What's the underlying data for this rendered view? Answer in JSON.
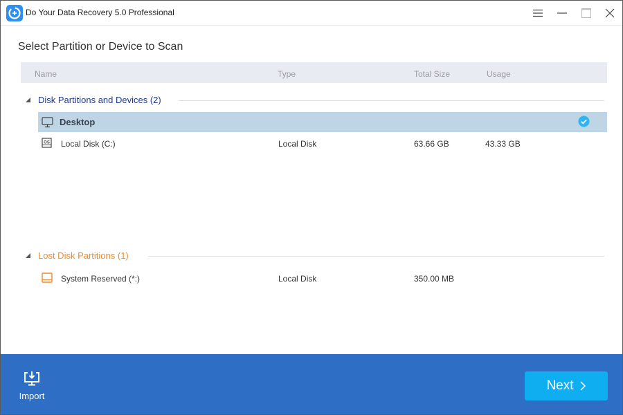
{
  "window": {
    "title": "Do Your Data Recovery 5.0 Professional",
    "controls": {
      "menu": "menu-icon",
      "minimize": "minimize-icon",
      "maximize": "maximize-icon",
      "close": "close-icon"
    }
  },
  "main": {
    "heading": "Select Partition or Device to Scan",
    "columns": [
      "Name",
      "Type",
      "Total Size",
      "Usage"
    ],
    "groups": [
      {
        "label": "Disk Partitions and Devices (2)",
        "color": "#1f3a93",
        "items": [
          {
            "name": "Desktop",
            "icon": "monitor-icon",
            "type": "",
            "total_size": "",
            "usage": "",
            "selected": true
          },
          {
            "name": "Local Disk (C:)",
            "icon": "os-disk-icon",
            "type": "Local Disk",
            "total_size": "63.66 GB",
            "usage": "43.33 GB",
            "selected": false
          }
        ]
      },
      {
        "label": "Lost Disk Partitions (1)",
        "color": "#f0892a",
        "items": [
          {
            "name": "System Reserved (*:)",
            "icon": "lost-disk-icon",
            "type": "Local Disk",
            "total_size": "350.00 MB",
            "usage": "",
            "selected": false
          }
        ]
      }
    ]
  },
  "footer": {
    "import_label": "Import",
    "next_label": "Next"
  },
  "colors": {
    "footer_bg": "#2e6ec4",
    "next_bg": "#0eaef0",
    "selected_row": "#bdd5e4",
    "check": "#2fb4f2"
  }
}
